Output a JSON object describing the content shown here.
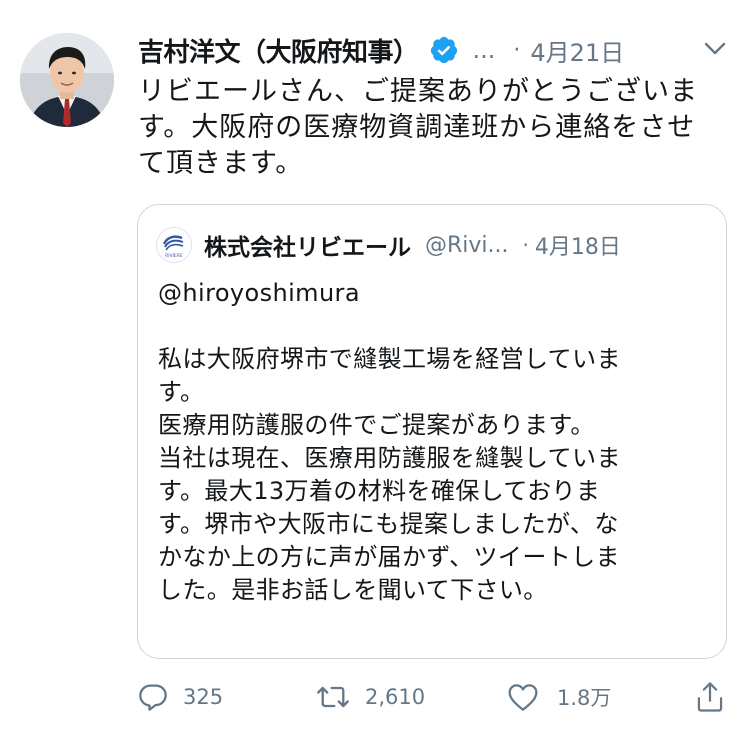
{
  "tweet": {
    "author_name": "吉村洋文（大阪府知事）",
    "handle_truncated": "...",
    "date": "4月21日",
    "separator": "·",
    "text_lines": [
      "リビエールさん、ご提案ありがとうございま",
      "す。大阪府の医療物資調達班から連絡をさせ",
      "て頂きます。"
    ]
  },
  "quote": {
    "author_name": "株式会社リビエール",
    "handle": "@Rivi...",
    "separator": "·",
    "date": "4月18日",
    "logo_text": "RIVIERE",
    "mention": "@hiroyoshimura",
    "body_lines": [
      "私は大阪府堺市で縫製工場を経営していま",
      "す。",
      "医療用防護服の件でご提案があります。",
      "当社は現在、医療用防護服を縫製していま",
      "す。最大13万着の材料を確保しておりま",
      "す。堺市や大阪市にも提案しましたが、な",
      "かなか上の方に声が届かず、ツイートしま",
      "した。是非お話しを聞いて下さい。"
    ]
  },
  "actions": {
    "reply_count": "325",
    "retweet_count": "2,610",
    "like_count": "1.8万"
  },
  "icons": {
    "verified": "verified-badge-icon",
    "caret": "chevron-down-icon",
    "reply": "reply-icon",
    "retweet": "retweet-icon",
    "like": "heart-icon",
    "share": "share-icon"
  },
  "colors": {
    "text": "#14171a",
    "secondary": "#657786",
    "verified": "#1da1f2",
    "border": "#ccd6dd"
  }
}
